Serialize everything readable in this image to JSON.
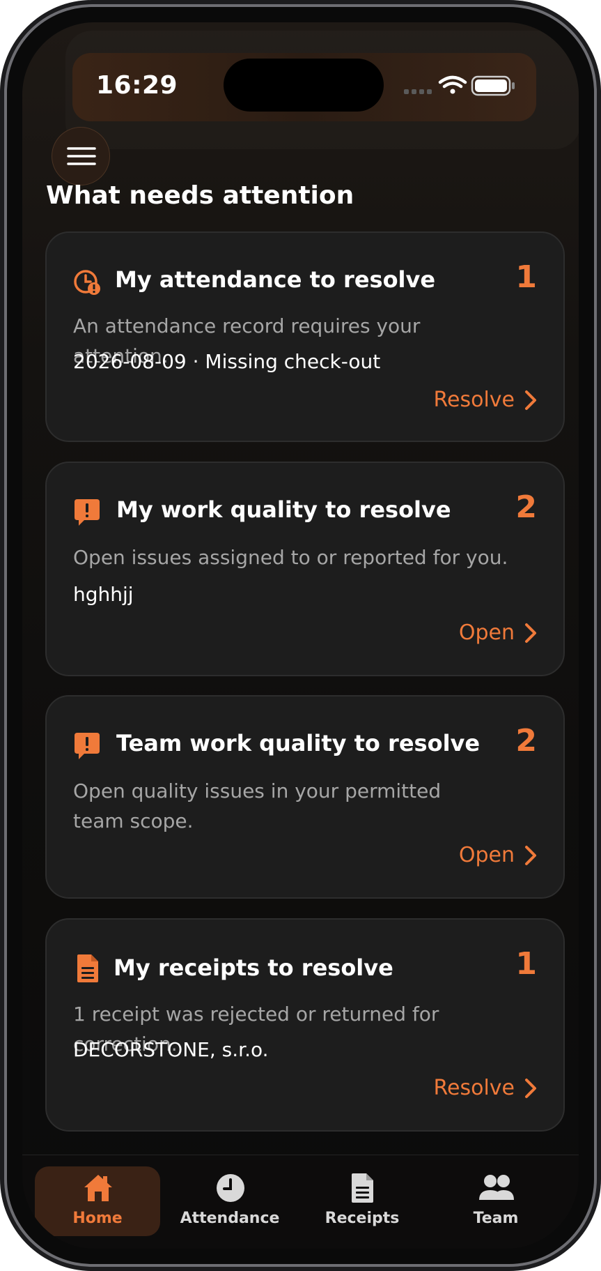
{
  "status_bar": {
    "time": "16:29"
  },
  "page": {
    "section_title": "What needs attention"
  },
  "cards": [
    {
      "icon": "clock-alert-icon",
      "title": "My attendance to resolve",
      "count": "1",
      "description": "An attendance record requires your attention.",
      "detail": "2026-08-09 · Missing check-out",
      "action": "Resolve"
    },
    {
      "icon": "chat-alert-icon",
      "title": "My work quality to resolve",
      "count": "2",
      "description": "Open issues assigned to or reported for you.",
      "detail": "hghhjj",
      "action": "Open"
    },
    {
      "icon": "chat-alert-icon",
      "title": "Team work quality to resolve",
      "count": "2",
      "description": "Open quality issues in your permitted team scope.",
      "detail": "",
      "action": "Open"
    },
    {
      "icon": "document-icon",
      "title": "My receipts to resolve",
      "count": "1",
      "description": "1 receipt was rejected or returned for correction.",
      "detail": "DECORSTONE, s.r.o.",
      "action": "Resolve"
    }
  ],
  "tabbar": {
    "items": [
      {
        "label": "Home",
        "icon": "home-icon",
        "active": true
      },
      {
        "label": "Attendance",
        "icon": "clock-icon",
        "active": false
      },
      {
        "label": "Receipts",
        "icon": "document-icon",
        "active": false
      },
      {
        "label": "Team",
        "icon": "team-icon",
        "active": false
      }
    ]
  },
  "colors": {
    "accent": "#f07a3a",
    "card_bg": "#1d1d1d",
    "text": "#ffffff",
    "muted": "#a6a6a6"
  }
}
